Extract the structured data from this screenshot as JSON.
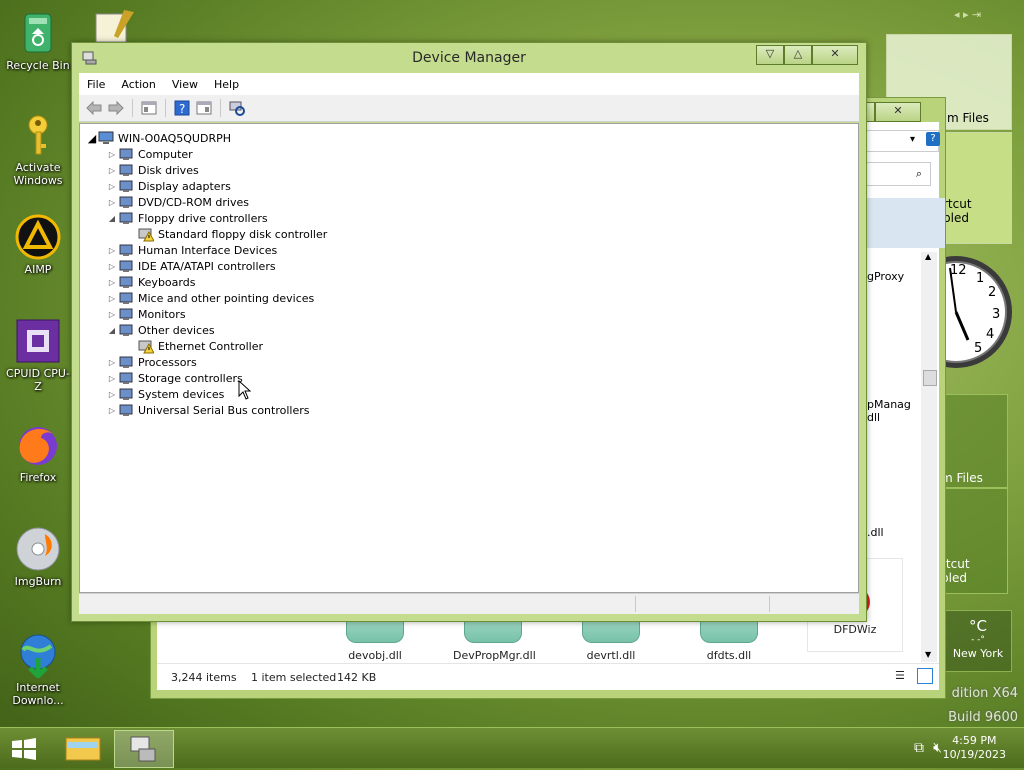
{
  "desktop_icons": [
    {
      "label": "Recycle Bin"
    },
    {
      "label": "Activate Windows"
    },
    {
      "label": "AIMP"
    },
    {
      "label": "CPUID CPU-Z"
    },
    {
      "label": "Firefox"
    },
    {
      "label": "ImgBurn"
    },
    {
      "label": "Internet Downlo..."
    }
  ],
  "gadgets": {
    "tile1_text": "m Files",
    "tile2_text1": "rtcut",
    "tile2_text2": "bled",
    "tile3_text": "m Files",
    "tile4_text1": "rtcut",
    "tile4_text2": "bled",
    "weather_unit": "°C",
    "weather_dash": "- -°",
    "weather_city": "New York"
  },
  "watermark": {
    "line1": "dition X64",
    "line2": "Build 9600"
  },
  "explorer": {
    "proxy_label": "gProxy",
    "manag_label1": "pManag",
    "manag_label2": "dll",
    "dll_label": ".dll",
    "files": [
      "devobj.dll",
      "DevPropMgr.dll",
      "devrtl.dll",
      "dfdts.dll",
      "DFDWiz"
    ],
    "status_items": "3,244 items",
    "status_selected": "1 item selected",
    "status_size": "142 KB"
  },
  "device_manager": {
    "title": "Device Manager",
    "menu": [
      "File",
      "Action",
      "View",
      "Help"
    ],
    "root": "WIN-O0AQ5QUDRPH",
    "nodes": [
      {
        "label": "Computer",
        "icon": "computer-icon",
        "expanded": false
      },
      {
        "label": "Disk drives",
        "icon": "disk-drive-icon",
        "expanded": false
      },
      {
        "label": "Display adapters",
        "icon": "display-adapter-icon",
        "expanded": false
      },
      {
        "label": "DVD/CD-ROM drives",
        "icon": "dvd-drive-icon",
        "expanded": false
      },
      {
        "label": "Floppy drive controllers",
        "icon": "floppy-controller-icon",
        "expanded": true
      },
      {
        "label": "Standard floppy disk controller",
        "icon": "warning-device-icon",
        "child": true
      },
      {
        "label": "Human Interface Devices",
        "icon": "hid-icon",
        "expanded": false
      },
      {
        "label": "IDE ATA/ATAPI controllers",
        "icon": "ide-controller-icon",
        "expanded": false
      },
      {
        "label": "Keyboards",
        "icon": "keyboard-icon",
        "expanded": false
      },
      {
        "label": "Mice and other pointing devices",
        "icon": "mouse-icon",
        "expanded": false
      },
      {
        "label": "Monitors",
        "icon": "monitor-icon",
        "expanded": false
      },
      {
        "label": "Other devices",
        "icon": "other-devices-icon",
        "expanded": true
      },
      {
        "label": "Ethernet Controller",
        "icon": "warning-device-icon",
        "child": true
      },
      {
        "label": "Processors",
        "icon": "processor-icon",
        "expanded": false
      },
      {
        "label": "Storage controllers",
        "icon": "storage-controller-icon",
        "expanded": false
      },
      {
        "label": "System devices",
        "icon": "system-devices-icon",
        "expanded": false
      },
      {
        "label": "Universal Serial Bus controllers",
        "icon": "usb-icon",
        "expanded": false
      }
    ]
  },
  "taskbar": {
    "time": "4:59 PM",
    "date": "10/19/2023"
  }
}
